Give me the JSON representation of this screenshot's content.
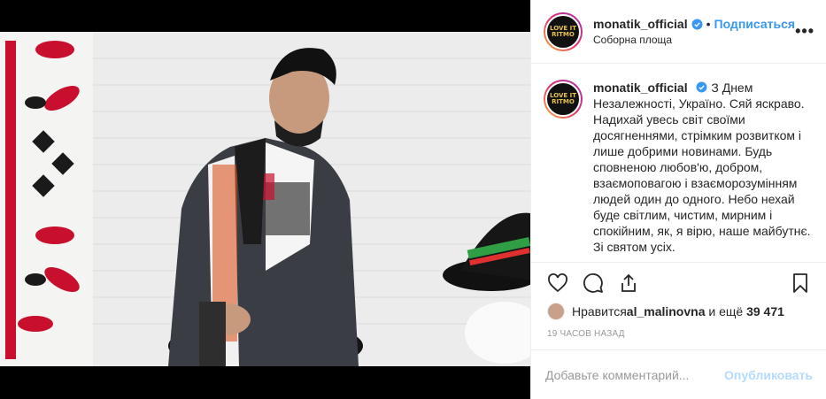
{
  "post": {
    "username": "monatik_official",
    "follow_label": "Подписаться",
    "dot": "•",
    "location": "Соборна площа",
    "more_label": "•••",
    "avatar_text": "LOVE IT RITMO",
    "caption": "З Днем Незалежності, Україно. Сяй яскраво. Надихай увесь світ своїми досягненнями, стрімким розвитком і лише добрими новинами. Будь сповненою любов'ю, добром, взаємоповагою і взаєморозумінням людей один до одного. Небо нехай буде світлим, чистим, мирним і спокійним, як, я вірю, наше майбутнє. Зі святом усіх."
  },
  "likes": {
    "prefix": "Нравится ",
    "user": "al_malinovna",
    "middle": " и ещё ",
    "count": "39 471"
  },
  "timestamp": "19 ЧАСОВ НАЗАД",
  "comment_box": {
    "placeholder": "Добавьте комментарий...",
    "publish_label": "Опубликовать"
  },
  "colors": {
    "accent": "#3897f0",
    "publish_disabled": "#b3dbff",
    "text": "#262626",
    "muted": "#999999"
  },
  "icons": [
    "verified-badge-icon",
    "heart-icon",
    "comment-icon",
    "share-icon",
    "bookmark-icon",
    "more-icon"
  ]
}
